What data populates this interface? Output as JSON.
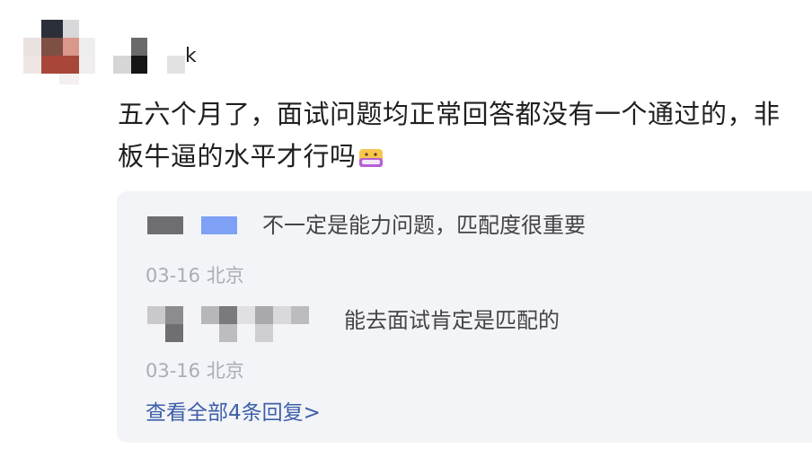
{
  "comment": {
    "username_visible_tail": "k",
    "text_line_1": "五六个月了，面试问题均正常回答都没有一个通过的，非",
    "text_line_2": "板牛逼的水平才行吗",
    "emoji_name": "sticker-emoji"
  },
  "replies": [
    {
      "text": "不一定是能力问题，匹配度很重要",
      "date": "03-16",
      "location": "北京"
    },
    {
      "text": "能去面试肯定是匹配的",
      "date": "03-16",
      "location": "北京"
    }
  ],
  "view_all_replies": "查看全部4条回复>",
  "colors": {
    "reply_background": "#f3f4f8",
    "link": "#3d5fa7",
    "meta": "#a9adb6"
  }
}
